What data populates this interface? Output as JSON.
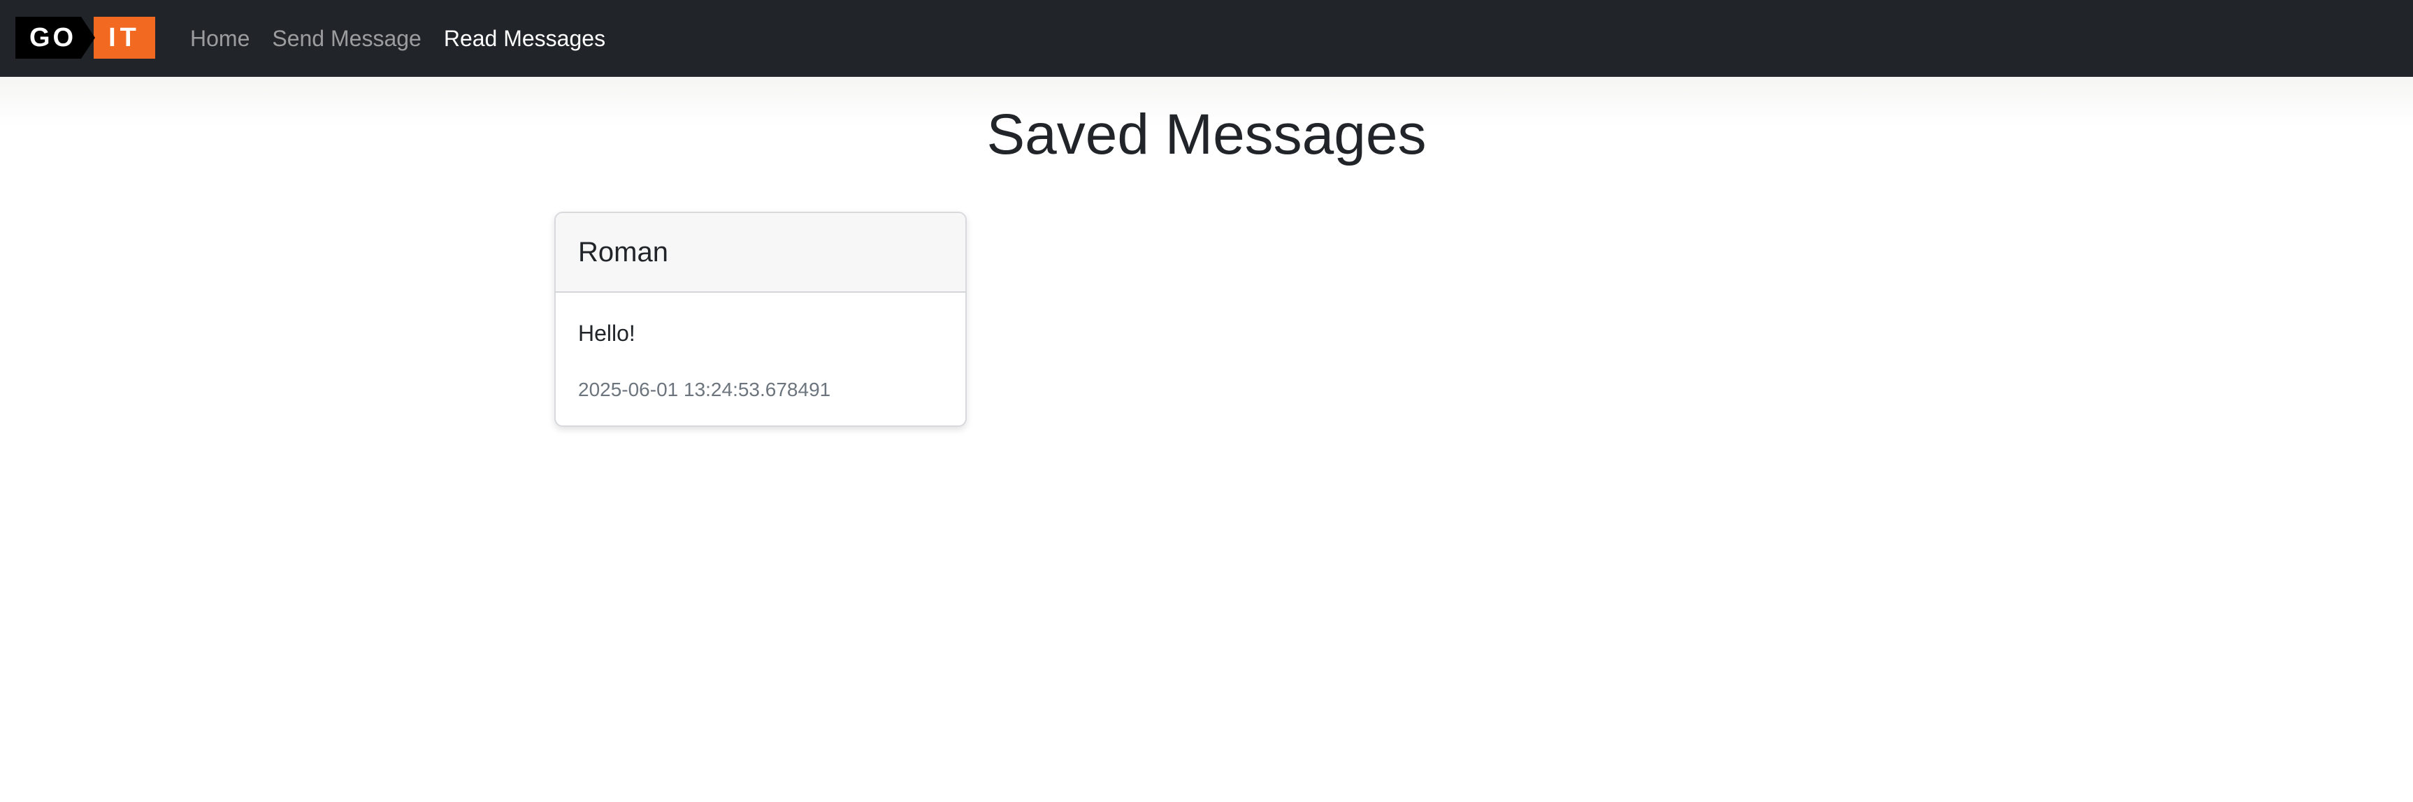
{
  "navbar": {
    "logo": {
      "left_text": "GO",
      "right_text": "IT",
      "accent_color": "#f26a21"
    },
    "links": [
      {
        "label": "Home",
        "active": false
      },
      {
        "label": "Send Message",
        "active": false
      },
      {
        "label": "Read Messages",
        "active": true
      }
    ]
  },
  "page": {
    "title": "Saved Messages"
  },
  "messages": [
    {
      "author": "Roman",
      "text": "Hello!",
      "timestamp": "2025-06-01 13:24:53.678491"
    }
  ]
}
